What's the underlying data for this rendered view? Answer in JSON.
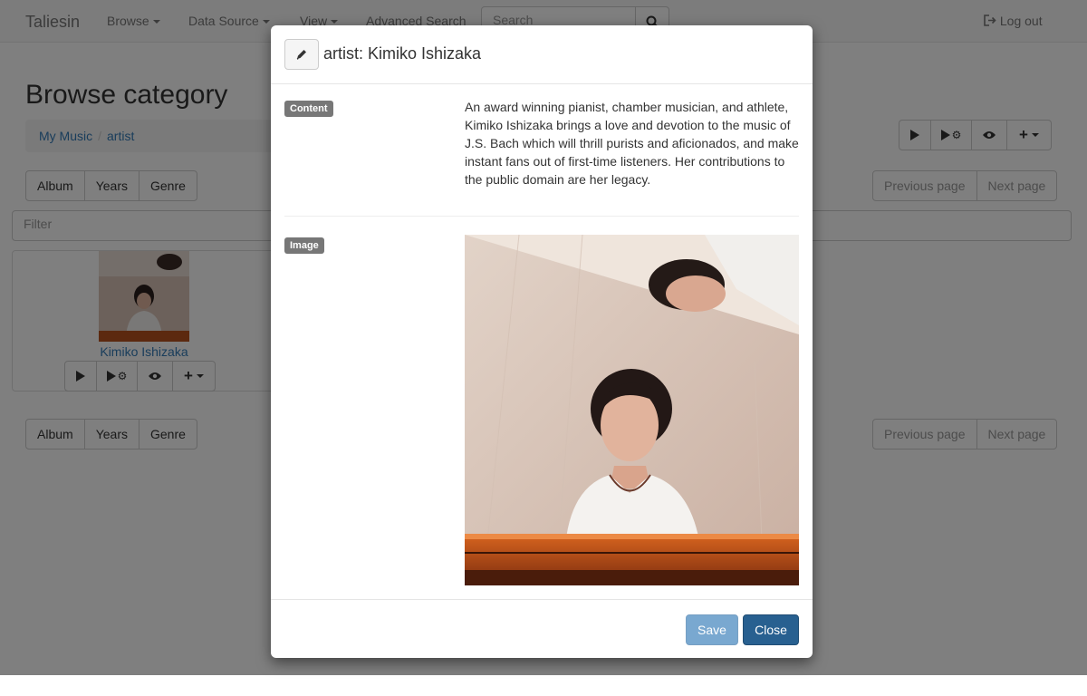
{
  "navbar": {
    "brand": "Taliesin",
    "items": [
      {
        "label": "Browse"
      },
      {
        "label": "Data Source"
      },
      {
        "label": "View"
      },
      {
        "label": "Advanced Search"
      }
    ],
    "search_placeholder": "Search",
    "logout_label": "Log out"
  },
  "page": {
    "title": "Browse category",
    "breadcrumb": [
      "My Music",
      "artist"
    ],
    "category_tabs": [
      "Album",
      "Years",
      "Genre"
    ],
    "pagination": {
      "previous": "Previous page",
      "next": "Next page"
    },
    "filter_placeholder": "Filter",
    "items": [
      {
        "name": "Kimiko Ishizaka"
      }
    ]
  },
  "modal": {
    "title": "artist: Kimiko Ishizaka",
    "content_label": "Content",
    "content_text": "An award winning pianist, chamber musician, and athlete, Kimiko Ishizaka brings a love and devotion to the music of J.S. Bach which will thrill purists and aficionados, and make instant fans out of first-time listeners. Her contributions to the public domain are her legacy.",
    "image_label": "Image",
    "save_label": "Save",
    "close_label": "Close"
  },
  "colors": {
    "link": "#337ab7",
    "primary": "#286090",
    "label_bg": "#777777",
    "overlay": "rgba(0,0,0,0.5)"
  },
  "icons": [
    "search-icon",
    "logout-icon",
    "play-icon",
    "play-settings-icon",
    "eye-icon",
    "plus-icon",
    "pencil-icon"
  ]
}
